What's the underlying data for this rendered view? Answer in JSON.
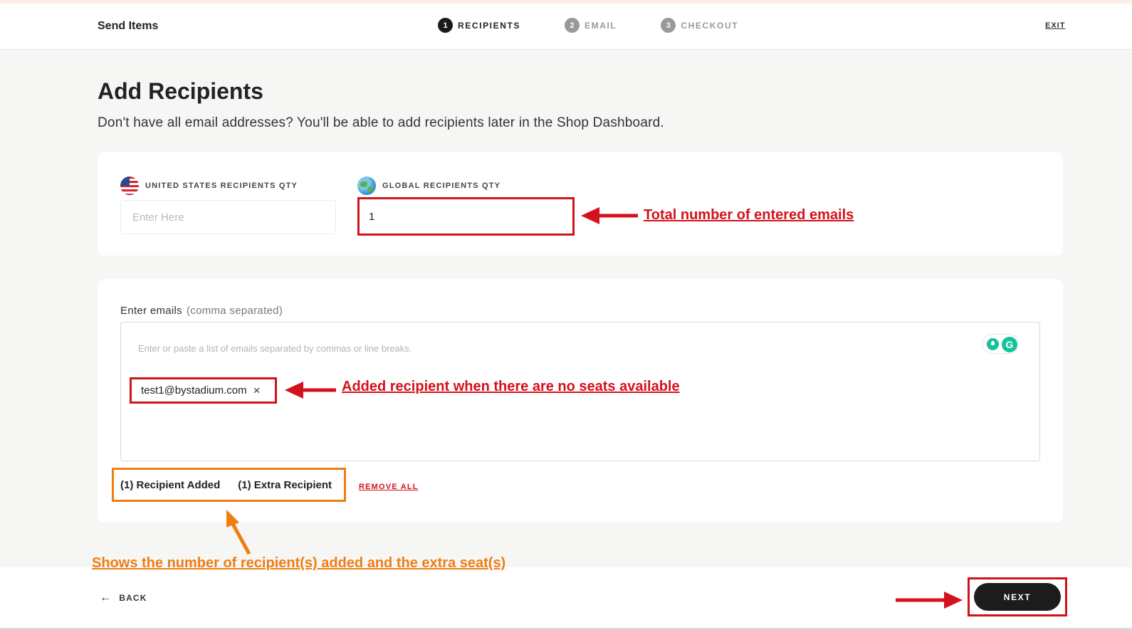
{
  "header": {
    "brand": "Send Items",
    "steps": [
      {
        "num": "1",
        "label": "RECIPIENTS"
      },
      {
        "num": "2",
        "label": "EMAIL"
      },
      {
        "num": "3",
        "label": "CHECKOUT"
      }
    ],
    "exit_label": "EXIT"
  },
  "main": {
    "title": "Add Recipients",
    "subtitle": "Don't have all email addresses? You'll be able to add recipients later in the Shop Dashboard.",
    "us_qty": {
      "label": "UNITED STATES RECIPIENTS QTY",
      "placeholder": "Enter Here",
      "value": "",
      "icon": "us-flag-icon"
    },
    "global_qty": {
      "label": "GLOBAL RECIPIENTS QTY",
      "value": "1",
      "icon": "globe-icon"
    },
    "emails": {
      "label": "Enter emails",
      "hint": "(comma separated)",
      "placeholder": "Enter or paste a list of emails separated by commas or line breaks.",
      "chips": [
        {
          "email": "test1@bystadium.com",
          "remove": "×"
        }
      ],
      "grammarly_letter": "G"
    },
    "counts": {
      "added": "(1) Recipient Added",
      "extra": "(1) Extra Recipient"
    },
    "remove_all": "REMOVE ALL"
  },
  "annotations": {
    "total": "Total number of entered emails",
    "no_seats": "Added recipient when there are no seats available",
    "counts": "Shows the number of recipient(s) added and the extra seat(s)"
  },
  "footer": {
    "back_label": "BACK",
    "back_icon": "←",
    "next_label": "NEXT"
  },
  "colors": {
    "annotation_red": "#d3121b",
    "annotation_orange": "#ef7d12",
    "primary_button": "#1c1c1c"
  }
}
